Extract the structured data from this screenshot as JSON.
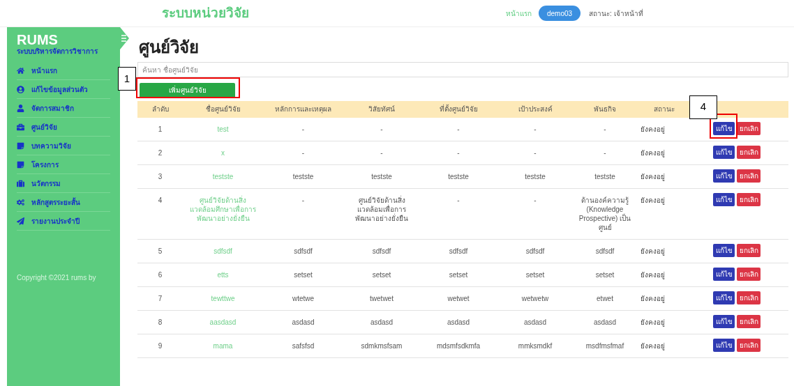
{
  "header": {
    "title": "ระบบหน่วยวิจัย",
    "nav_link": "หน้าแรก",
    "user_button": "demo03",
    "status_text": "สถานะ: เจ้าหน้าที่"
  },
  "sidebar": {
    "brand": "RUMS",
    "subtitle": "ระบบบริหารจัดการวิชาการ",
    "items": [
      {
        "label": "หน้าแรก"
      },
      {
        "label": "แก้ไขข้อมูลส่วนตัว"
      },
      {
        "label": "จัดการสมาชิก"
      },
      {
        "label": "ศูนย์วิจัย"
      },
      {
        "label": "บทความวิจัย"
      },
      {
        "label": "โครงการ"
      },
      {
        "label": "นวัตกรรม"
      },
      {
        "label": "หลักสูตรระยะสั้น"
      },
      {
        "label": "รายงานประจำปี"
      }
    ],
    "copyright": "Copyright ©2021 rums by"
  },
  "page_title": "ศูนย์วิจัย",
  "search": {
    "placeholder": "ค้นหา ชื่อศูนย์วิจัย"
  },
  "add_button": {
    "label": "เพิ่มศูนย์วิจัย",
    "callout": "1"
  },
  "table": {
    "columns": [
      "ลำดับ",
      "ชื่อศูนย์วิจัย",
      "หลักการและเหตุผล",
      "วิสัยทัศน์",
      "ที่ตั้งศูนย์วิจัย",
      "เป้าประสงค์",
      "พันธกิจ",
      "สถานะ"
    ],
    "rows": [
      {
        "cells": [
          "1",
          "test",
          "-",
          "-",
          "-",
          "-",
          "-",
          "ยังคงอยู่"
        ],
        "edit": "แก้ไข",
        "cancel": "ยกเลิก",
        "callout": "4"
      },
      {
        "cells": [
          "2",
          "x",
          "-",
          "-",
          "-",
          "-",
          "-",
          "ยังคงอยู่"
        ],
        "edit": "แก้ไข",
        "cancel": "ยกเลิก"
      },
      {
        "cells": [
          "3",
          "testste",
          "testste",
          "testste",
          "testste",
          "testste",
          "testste",
          "ยังคงอยู่"
        ],
        "edit": "แก้ไข",
        "cancel": "ยกเลิก"
      },
      {
        "cells": [
          "4",
          "ศูนย์วิจัยด้านสิ่งแวดล้อมศึกษาเพื่อการพัฒนาอย่างยั่งยืน",
          "-",
          "ศูนย์วิจัยด้านสิ่งแวดล้อมเพื่อการพัฒนาอย่างยั่งยืน",
          "-",
          "-",
          "ด้านองค์ความรู้ (Knowledge Prospective) เป็นศูนย์",
          "ยังคงอยู่"
        ],
        "edit": "แก้ไข",
        "cancel": "ยกเลิก"
      },
      {
        "cells": [
          "5",
          "sdfsdf",
          "sdfsdf",
          "sdfsdf",
          "sdfsdf",
          "sdfsdf",
          "sdfsdf",
          "ยังคงอยู่"
        ],
        "edit": "แก้ไข",
        "cancel": "ยกเลิก"
      },
      {
        "cells": [
          "6",
          "etts",
          "setset",
          "setset",
          "setset",
          "setset",
          "setset",
          "ยังคงอยู่"
        ],
        "edit": "แก้ไข",
        "cancel": "ยกเลิก"
      },
      {
        "cells": [
          "7",
          "tewttwe",
          "wtetwe",
          "twetwet",
          "wetwet",
          "wetwetw",
          "etwet",
          "ยังคงอยู่"
        ],
        "edit": "แก้ไข",
        "cancel": "ยกเลิก"
      },
      {
        "cells": [
          "8",
          "aasdasd",
          "asdasd",
          "asdasd",
          "asdasd",
          "asdasd",
          "asdasd",
          "ยังคงอยู่"
        ],
        "edit": "แก้ไข",
        "cancel": "ยกเลิก"
      },
      {
        "cells": [
          "9",
          "mama",
          "safsfsd",
          "sdmkmsfsam",
          "mdsmfsdkmfa",
          "mmksmdkf",
          "msdfmsfmaf",
          "ยังคงอยู่"
        ],
        "edit": "แก้ไข",
        "cancel": "ยกเลิก"
      }
    ]
  }
}
